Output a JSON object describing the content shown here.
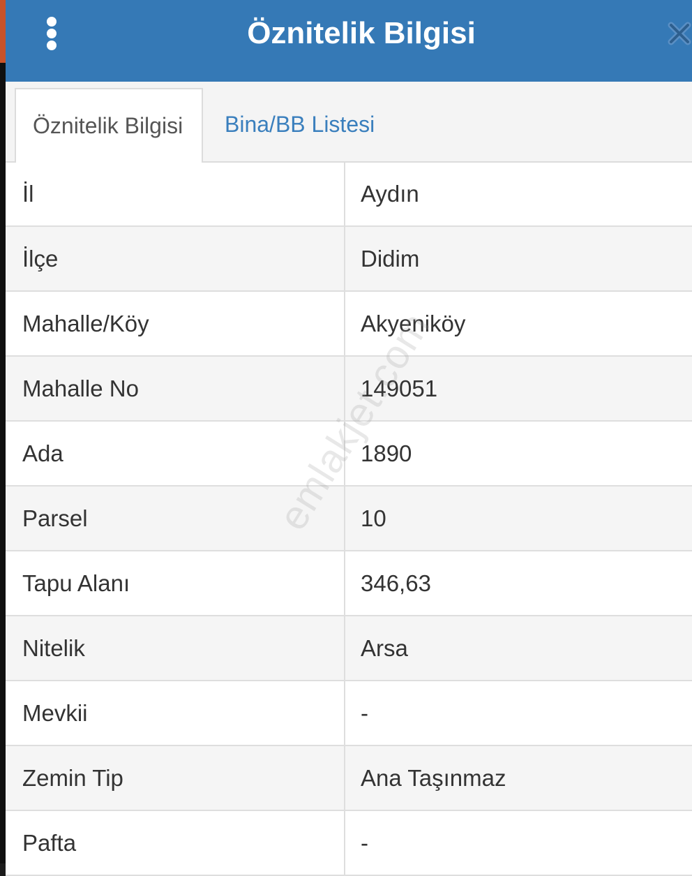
{
  "header": {
    "title": "Öznitelik Bilgisi",
    "menu_icon": "vertical-dots-icon",
    "close_icon": "close-icon",
    "color": "#3579b6"
  },
  "tabs": [
    {
      "label": "Öznitelik Bilgisi",
      "active": true
    },
    {
      "label": "Bina/BB Listesi",
      "active": false
    }
  ],
  "rows": [
    {
      "label": "İl",
      "value": "Aydın"
    },
    {
      "label": "İlçe",
      "value": "Didim"
    },
    {
      "label": "Mahalle/Köy",
      "value": "Akyeniköy"
    },
    {
      "label": "Mahalle No",
      "value": "149051"
    },
    {
      "label": "Ada",
      "value": "1890"
    },
    {
      "label": "Parsel",
      "value": "10"
    },
    {
      "label": "Tapu Alanı",
      "value": "346,63"
    },
    {
      "label": "Nitelik",
      "value": "Arsa"
    },
    {
      "label": "Mevkii",
      "value": "-"
    },
    {
      "label": "Zemin Tip",
      "value": "Ana Taşınmaz"
    },
    {
      "label": "Pafta",
      "value": "-"
    }
  ],
  "watermark": "emlakjet.com",
  "colors": {
    "accent": "#3579b6",
    "tab_link": "#3a7fbd"
  }
}
